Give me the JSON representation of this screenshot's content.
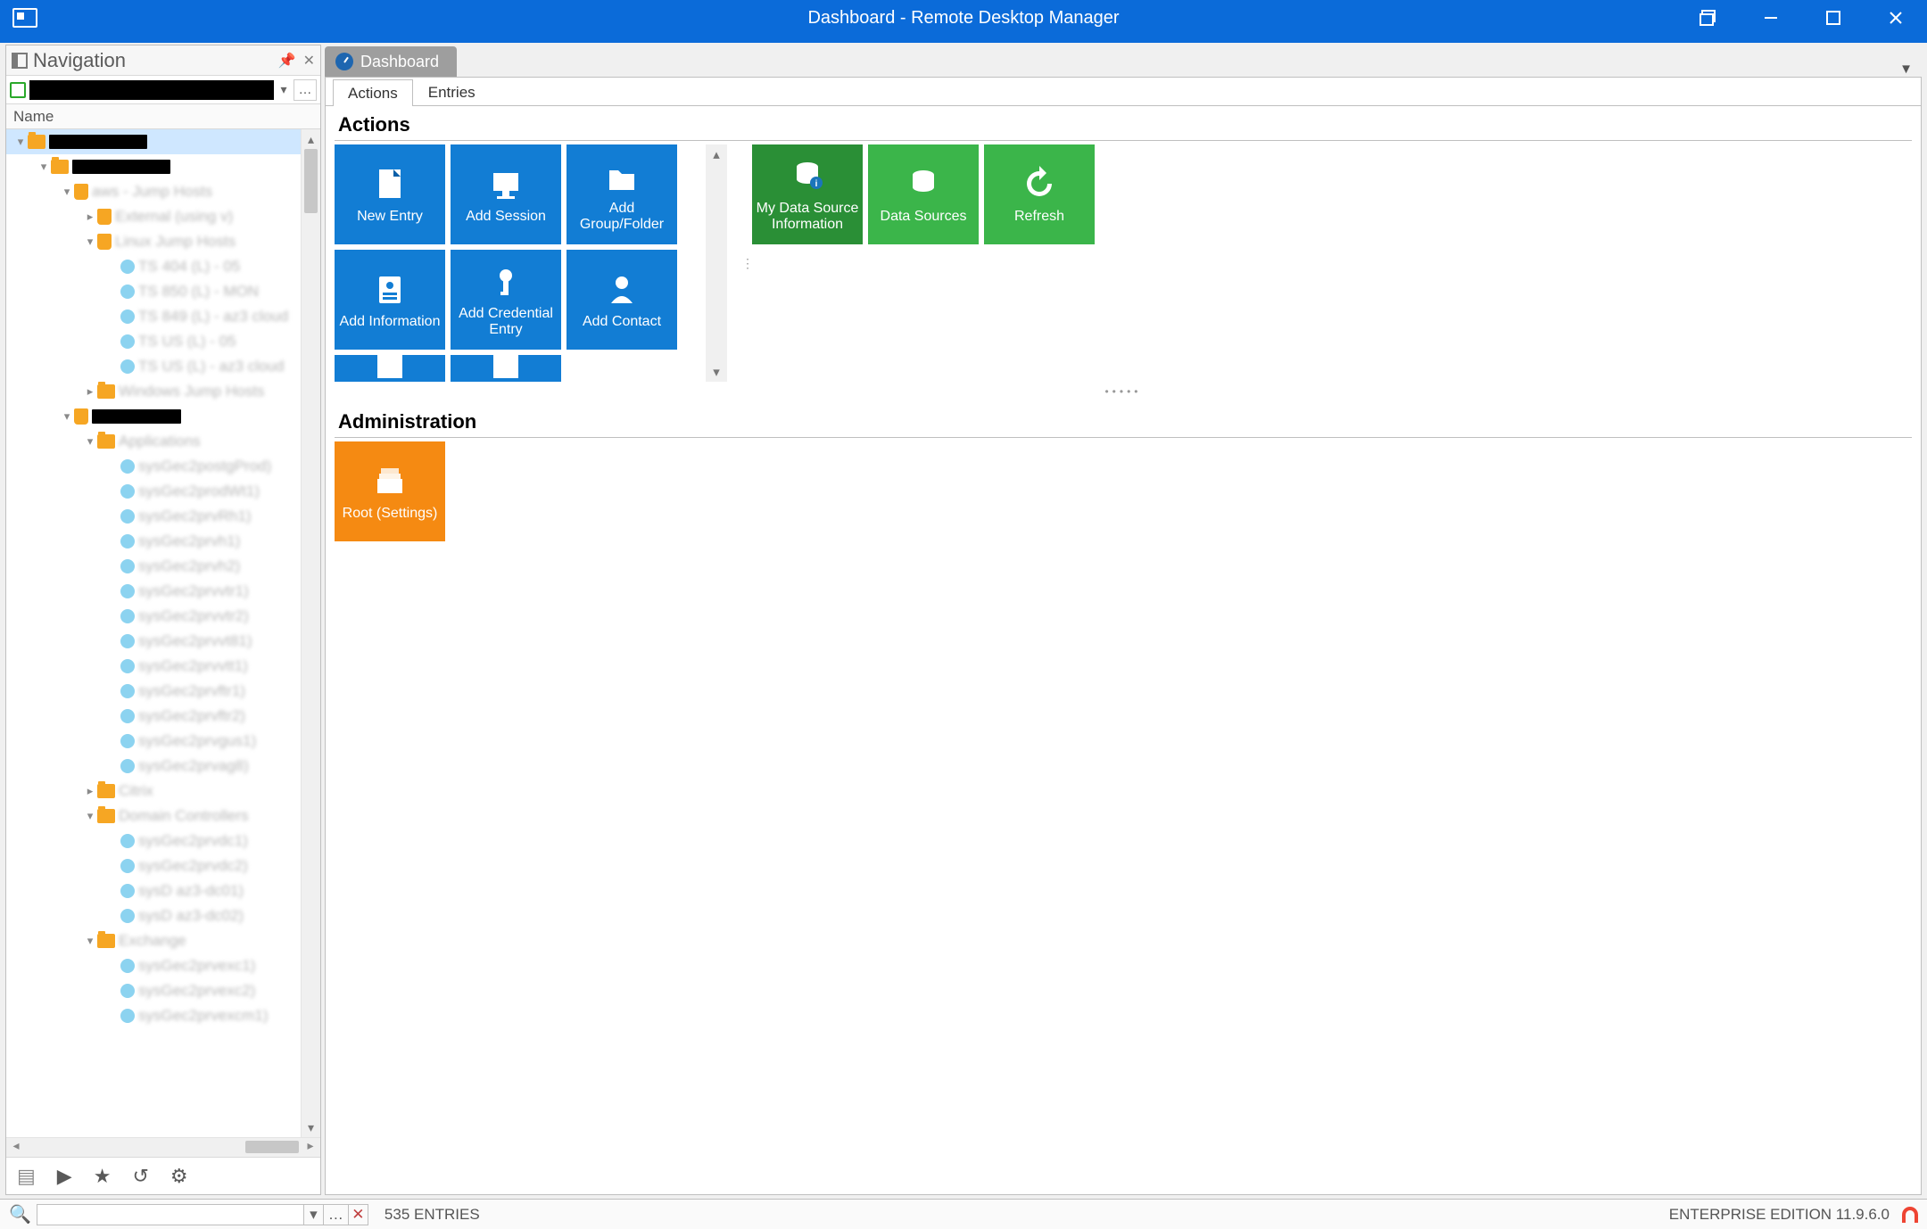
{
  "titlebar": {
    "title": "Dashboard - Remote Desktop Manager"
  },
  "navigation": {
    "title": "Navigation",
    "column_header": "Name",
    "tree": [
      {
        "level": 0,
        "twisty": "▾",
        "icon": "fi-folder",
        "selected": true,
        "redact_w": 110
      },
      {
        "level": 1,
        "twisty": "▾",
        "icon": "fi-folder",
        "redact_w": 110
      },
      {
        "level": 2,
        "twisty": "▾",
        "icon": "fi-shield",
        "blur_text": "aws - Jump Hosts"
      },
      {
        "level": 3,
        "twisty": "▸",
        "icon": "fi-shield",
        "blur_text": "External (using v)"
      },
      {
        "level": 3,
        "twisty": "▾",
        "icon": "fi-shield",
        "blur_text": "Linux Jump Hosts"
      },
      {
        "level": 4,
        "twisty": "",
        "icon": "fi-circle",
        "blur_text": "TS 404 (L) - 05"
      },
      {
        "level": 4,
        "twisty": "",
        "icon": "fi-circle",
        "blur_text": "TS 850 (L) - MON"
      },
      {
        "level": 4,
        "twisty": "",
        "icon": "fi-circle",
        "blur_text": "TS 849 (L) - az3 cloud"
      },
      {
        "level": 4,
        "twisty": "",
        "icon": "fi-circle",
        "blur_text": "TS US (L) - 05"
      },
      {
        "level": 4,
        "twisty": "",
        "icon": "fi-circle",
        "blur_text": "TS US (L) - az3 cloud"
      },
      {
        "level": 3,
        "twisty": "▸",
        "icon": "fi-folder",
        "blur_text": "Windows Jump Hosts"
      },
      {
        "level": 2,
        "twisty": "▾",
        "icon": "fi-shield",
        "redact_w": 100
      },
      {
        "level": 3,
        "twisty": "▾",
        "icon": "fi-folder",
        "blur_text": "Applications"
      },
      {
        "level": 4,
        "twisty": "",
        "icon": "fi-circle",
        "blur_text": "sysGec2postgProd)"
      },
      {
        "level": 4,
        "twisty": "",
        "icon": "fi-circle",
        "blur_text": "sysGec2prodWt1)"
      },
      {
        "level": 4,
        "twisty": "",
        "icon": "fi-circle",
        "blur_text": "sysGec2prvRh1)"
      },
      {
        "level": 4,
        "twisty": "",
        "icon": "fi-circle",
        "blur_text": "sysGec2prvh1)"
      },
      {
        "level": 4,
        "twisty": "",
        "icon": "fi-circle",
        "blur_text": "sysGec2prvh2)"
      },
      {
        "level": 4,
        "twisty": "",
        "icon": "fi-circle",
        "blur_text": "sysGec2prvvtr1)"
      },
      {
        "level": 4,
        "twisty": "",
        "icon": "fi-circle",
        "blur_text": "sysGec2prvvtr2)"
      },
      {
        "level": 4,
        "twisty": "",
        "icon": "fi-circle",
        "blur_text": "sysGec2prvvt81)"
      },
      {
        "level": 4,
        "twisty": "",
        "icon": "fi-circle",
        "blur_text": "sysGec2prvvtt1)"
      },
      {
        "level": 4,
        "twisty": "",
        "icon": "fi-circle",
        "blur_text": "sysGec2prvftr1)"
      },
      {
        "level": 4,
        "twisty": "",
        "icon": "fi-circle",
        "blur_text": "sysGec2prvftr2)"
      },
      {
        "level": 4,
        "twisty": "",
        "icon": "fi-circle",
        "blur_text": "sysGec2prvgus1)"
      },
      {
        "level": 4,
        "twisty": "",
        "icon": "fi-circle",
        "blur_text": "sysGec2prvag8)"
      },
      {
        "level": 3,
        "twisty": "▸",
        "icon": "fi-folder",
        "blur_text": "Citrix"
      },
      {
        "level": 3,
        "twisty": "▾",
        "icon": "fi-folder",
        "blur_text": "Domain Controllers"
      },
      {
        "level": 4,
        "twisty": "",
        "icon": "fi-circle",
        "blur_text": "sysGec2prvdc1)"
      },
      {
        "level": 4,
        "twisty": "",
        "icon": "fi-circle",
        "blur_text": "sysGec2prvdc2)"
      },
      {
        "level": 4,
        "twisty": "",
        "icon": "fi-circle",
        "blur_text": "sysD az3-dc01)"
      },
      {
        "level": 4,
        "twisty": "",
        "icon": "fi-circle",
        "blur_text": "sysD az3-dc02)"
      },
      {
        "level": 3,
        "twisty": "▾",
        "icon": "fi-folder",
        "blur_text": "Exchange"
      },
      {
        "level": 4,
        "twisty": "",
        "icon": "fi-circle",
        "blur_text": "sysGec2prvexc1)"
      },
      {
        "level": 4,
        "twisty": "",
        "icon": "fi-circle",
        "blur_text": "sysGec2prvexc2)"
      },
      {
        "level": 4,
        "twisty": "",
        "icon": "fi-circle",
        "blur_text": "sysGec2prvexcm1)"
      }
    ]
  },
  "dashboard": {
    "tab_label": "Dashboard",
    "inner_tabs": {
      "actions": "Actions",
      "entries": "Entries"
    },
    "sections": {
      "actions": "Actions",
      "administration": "Administration"
    },
    "tiles_blue": [
      "New Entry",
      "Add Session",
      "Add Group/Folder",
      "Add Information",
      "Add Credential Entry",
      "Add Contact"
    ],
    "tiles_green": [
      "My Data Source Information",
      "Data Sources",
      "Refresh"
    ],
    "tile_admin": "Root (Settings)"
  },
  "statusbar": {
    "entries": "535 ENTRIES",
    "edition": "ENTERPRISE EDITION 11.9.6.0"
  }
}
